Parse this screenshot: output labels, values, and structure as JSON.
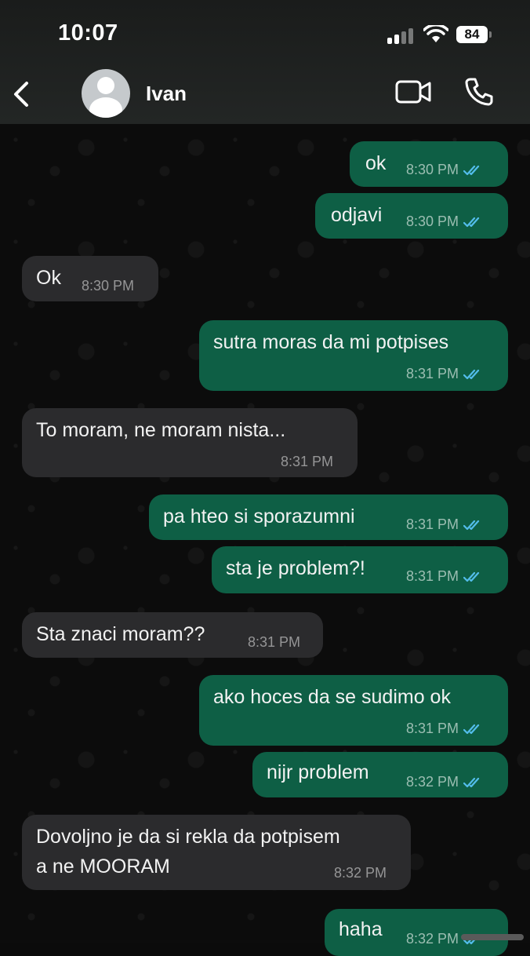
{
  "status_bar": {
    "time": "10:07",
    "battery": "84"
  },
  "header": {
    "contact_name": "Ivan"
  },
  "icons": {
    "back": "chevron-left-icon",
    "avatar": "person-icon",
    "video": "video-camera-icon",
    "call": "phone-icon",
    "read": "double-check-icon"
  },
  "colors": {
    "outgoing_bubble": "#0e5f45",
    "incoming_bubble": "#2b2b2d",
    "read_ticks": "#53bdeb"
  },
  "messages": [
    {
      "direction": "out",
      "text": "ok",
      "time": "8:30 PM",
      "read": true
    },
    {
      "direction": "out",
      "text": "odjavi",
      "time": "8:30 PM",
      "read": true
    },
    {
      "direction": "in",
      "text": "Ok",
      "time": "8:30 PM"
    },
    {
      "direction": "out",
      "text": "sutra moras da mi potpises",
      "time": "8:31 PM",
      "read": true
    },
    {
      "direction": "in",
      "text": "To moram, ne moram nista...",
      "time": "8:31 PM"
    },
    {
      "direction": "out",
      "text": "pa hteo si sporazumni",
      "time": "8:31 PM",
      "read": true
    },
    {
      "direction": "out",
      "text": "sta je problem?!",
      "time": "8:31 PM",
      "read": true
    },
    {
      "direction": "in",
      "text": "Sta znaci moram??",
      "time": "8:31 PM"
    },
    {
      "direction": "out",
      "text": "ako hoces da se sudimo ok",
      "time": "8:31 PM",
      "read": true
    },
    {
      "direction": "out",
      "text": "nijr problem",
      "time": "8:32 PM",
      "read": true
    },
    {
      "direction": "in",
      "text": "Dovoljno je da si rekla da potpisem",
      "text_line2": "a ne MOORAM",
      "time": "8:32 PM"
    },
    {
      "direction": "out",
      "text": "haha",
      "time": "8:32 PM",
      "read": true
    }
  ]
}
